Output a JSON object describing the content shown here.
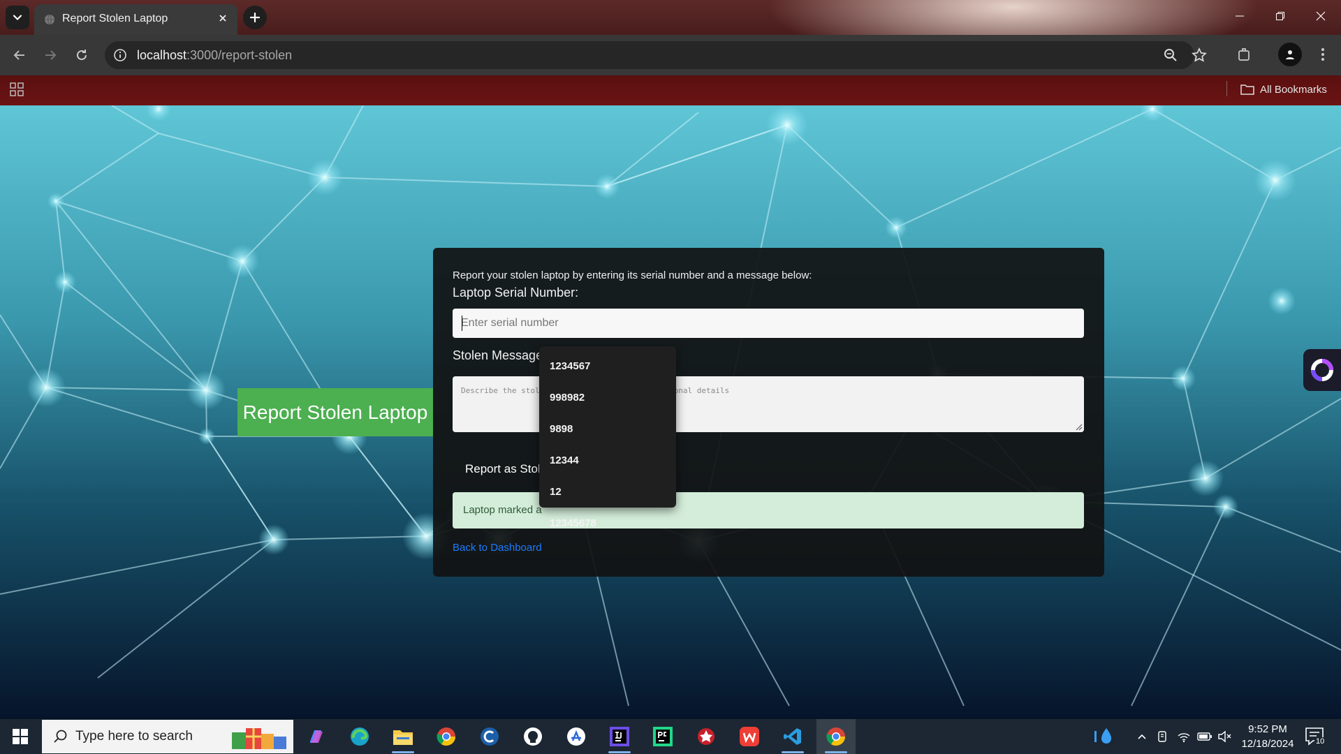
{
  "browser": {
    "tab_title": "Report Stolen Laptop",
    "url_host": "localhost",
    "url_rest": ":3000/report-stolen",
    "all_bookmarks_label": "All Bookmarks"
  },
  "page": {
    "banner_title": "Report Stolen Laptop",
    "intro_text": "Report your stolen laptop by entering its serial number and a message below:",
    "serial_label": "Laptop Serial Number:",
    "serial_placeholder": "Enter serial number",
    "serial_value": "",
    "message_label_visible": "Stolen Message",
    "message_placeholder": "Describe the stolen incident or provide additional details",
    "report_button_visible": "Report as Stol",
    "success_visible": "Laptop marked a",
    "back_link": "Back to Dashboard"
  },
  "autocomplete": {
    "options": [
      "1234567",
      "998982",
      "9898",
      "12344",
      "12",
      "12345678"
    ]
  },
  "taskbar": {
    "search_placeholder": "Type here to search",
    "time": "9:52 PM",
    "date": "12/18/2024",
    "notification_count": "10",
    "apps": [
      "copilot-icon",
      "edge-icon",
      "file-explorer-icon",
      "chrome-icon",
      "ccleaner-icon",
      "github-icon",
      "app-store-icon",
      "intellij-icon",
      "pycharm-icon",
      "antivirus-icon",
      "wps-office-icon",
      "vscode-icon",
      "chrome-active-icon"
    ]
  },
  "colors": {
    "banner_green": "#4caf50",
    "success_bg": "#d4edda",
    "link_blue": "#1e7bff",
    "card_bg": "#121212"
  }
}
